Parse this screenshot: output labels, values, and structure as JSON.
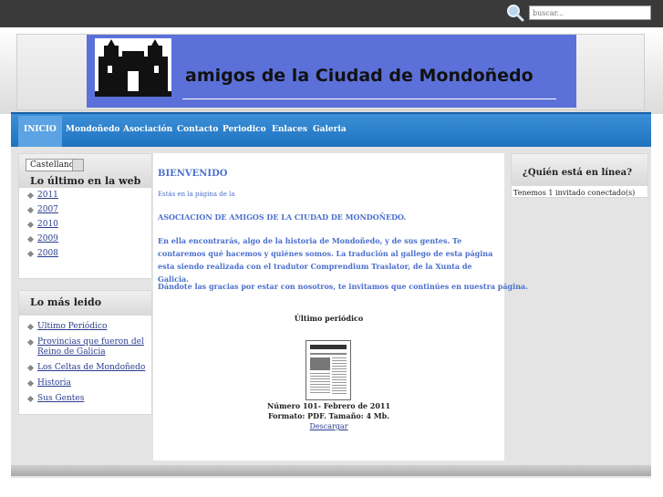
{
  "search": {
    "placeholder": "buscar..."
  },
  "header": {
    "title": "amigos de la Ciudad de Mondoñedo"
  },
  "nav": [
    {
      "label": "INICIO"
    },
    {
      "label": "Mondoñedo"
    },
    {
      "label": "Asociación"
    },
    {
      "label": "Contacto"
    },
    {
      "label": "Periodico"
    },
    {
      "label": "Enlaces"
    },
    {
      "label": "Galeria"
    }
  ],
  "language": {
    "selected": "Castellano"
  },
  "latest": {
    "title": "Lo último en la web",
    "items": [
      "2011",
      "2007",
      "2010",
      "2009",
      "2008"
    ]
  },
  "most_read": {
    "title": "Lo más leido",
    "items": [
      "Ultimo Periódico",
      "Provincias que fueron del Reino de Galicia",
      "Los Celtas de Mondoñedo",
      "Historia",
      "Sus Gentes"
    ]
  },
  "main": {
    "welcome": "BIENVENIDO",
    "intro": "Estás en la página de la",
    "association": "ASOCIACION DE AMIGOS DE LA CIUDAD DE MONDOÑEDO.",
    "body": "En ella encontrarás, algo de la historia de Mondoñedo, y de sus gentes. Te contaremos qué hacemos y quiénes somos.  La tradución al gallego de esta página esta siendo realizada con el  tradutor Comprendium Traslator, de la Xunta de Galicia.",
    "thanks": "Dándote las gracias por estar con nosotros, te invitamos que continúes en nuestra página.",
    "last_issue_title": "Último periódico",
    "issue_number": "Número 101- Febrero de 2011",
    "issue_format": "Formato: PDF. Tamaño: 4 Mb.",
    "download": "Descargar"
  },
  "online": {
    "title": "¿Quién está en línea?",
    "text": "Tenemos 1 invitado conectado(s)"
  }
}
